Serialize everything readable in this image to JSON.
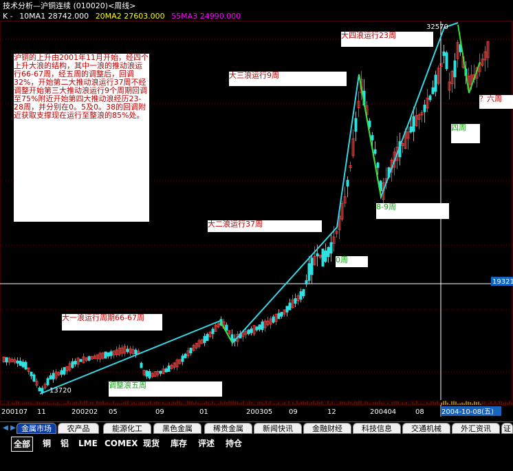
{
  "window_title": "技术分析—沪铜连续 (010020)<周线>",
  "ma_legend": {
    "k": "K - ",
    "ma1": "10MA1 28742.000",
    "ma2": "20MA2 27603.000",
    "ma3": "55MA3 24990.000"
  },
  "colors": {
    "ma1": "#ffffff",
    "ma2": "#ffff00",
    "ma3": "#ff00ff",
    "wave_line": "#37d7e6",
    "correction_line": "#39e039",
    "up_candle": "#ff3030",
    "down_candle": "#30e0e0"
  },
  "chart_data": {
    "type": "candlestick",
    "title": "技术分析—沪铜连续 (010020)<周线>",
    "x_tick_labels": [
      "200107",
      "11",
      "200202",
      "05",
      "09",
      "01",
      "200305",
      "09",
      "12",
      "200404",
      "08",
      "2004-10-08(五)"
    ],
    "price_labels": {
      "high": "32570",
      "low": "13720",
      "crosshair": "19321"
    },
    "annotations": [
      {
        "id": "summary",
        "text": "沪铜的上升由2001年11月开始，经四个上升大浪的结构，其中一浪的推动浪运行66-67周，经五周的调整后，回调32%，开始第二大推动浪运行37周不经调整开始第三大推动浪运行9个周期回调至75%附近开始第四大推动浪经历23-28周，并分别在0。5及0。38的回调附近获取支撑现在运行至整浪的85%处。"
      },
      {
        "id": "w1",
        "text": "大一浪运行周期66-67周"
      },
      {
        "id": "adj5",
        "text": "调整浪五周"
      },
      {
        "id": "w2",
        "text": "大二浪运行37周"
      },
      {
        "id": "zero",
        "text": "0周"
      },
      {
        "id": "w3",
        "text": "大三浪运行9周"
      },
      {
        "id": "w89",
        "text": "8-9周"
      },
      {
        "id": "w4",
        "text": "大四浪运行23周"
      },
      {
        "id": "four",
        "text": "四周"
      },
      {
        "id": "six",
        "text": "？六周"
      }
    ]
  },
  "tabs": [
    "金属市场",
    "农产品",
    "能源化工",
    "黑色金属",
    "稀贵金属",
    "新闻快讯",
    "金融财经",
    "科技信息",
    "交通机械",
    "外汇资讯",
    "证"
  ],
  "subtabs": [
    "全部",
    "铜",
    "铝",
    "LME",
    "COMEX",
    "现货",
    "库存",
    "评述",
    "持仓"
  ]
}
